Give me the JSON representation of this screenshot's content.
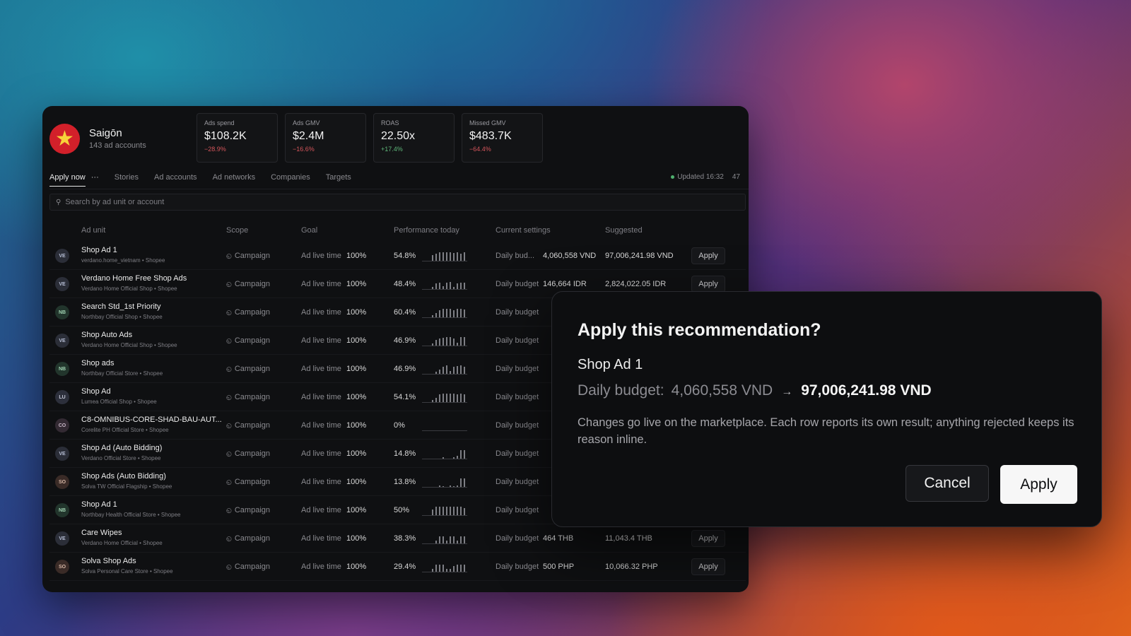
{
  "org": {
    "name": "Saigōn",
    "subtitle": "143 ad accounts"
  },
  "kpis": [
    {
      "label": "Ads spend",
      "value": "$108.2K",
      "delta": "−28.9%",
      "trend": "negative"
    },
    {
      "label": "Ads GMV",
      "value": "$2.4M",
      "delta": "−16.6%",
      "trend": "negative"
    },
    {
      "label": "ROAS",
      "value": "22.50x",
      "delta": "+17.4%",
      "trend": "positive"
    },
    {
      "label": "Missed GMV",
      "value": "$483.7K",
      "delta": "−64.4%",
      "trend": "negative"
    }
  ],
  "tabs": {
    "apply_now": "Apply now",
    "more": "···",
    "stories": "Stories",
    "ad_accounts": "Ad accounts",
    "ad_networks": "Ad networks",
    "companies": "Companies",
    "targets": "Targets"
  },
  "status": {
    "updated": "Updated 16:32",
    "count": "47"
  },
  "search": {
    "placeholder": "Search by ad unit or account"
  },
  "columns": {
    "ad_unit": "Ad unit",
    "scope": "Scope",
    "goal": "Goal",
    "performance": "Performance today",
    "current": "Current settings",
    "suggested": "Suggested"
  },
  "rows": [
    {
      "initials": "VE",
      "name": "Shop Ad 1",
      "sub": "verdano.home_vietnam • Shopee",
      "scope": "Campaign",
      "goal": "Ad live time",
      "goal_pct": "100%",
      "perf": "54.8%",
      "setting_label": "Daily bud...",
      "setting_value": "4,060,558 VND",
      "suggested": "97,006,241.98 VND",
      "apply": "Apply"
    },
    {
      "initials": "VE",
      "name": "Verdano Home Free Shop Ads",
      "sub": "Verdano Home Official Shop • Shopee",
      "scope": "Campaign",
      "goal": "Ad live time",
      "goal_pct": "100%",
      "perf": "48.4%",
      "setting_label": "Daily budget",
      "setting_value": "146,664 IDR",
      "suggested": "2,824,022.05 IDR",
      "apply": "Apply"
    },
    {
      "initials": "NB",
      "name": "Search Std_1st Priority",
      "sub": "Northbay Official Shop • Shopee",
      "scope": "Campaign",
      "goal": "Ad live time",
      "goal_pct": "100%",
      "perf": "60.4%",
      "setting_label": "Daily budget",
      "setting_value": "",
      "suggested": "",
      "apply": ""
    },
    {
      "initials": "VE",
      "name": "Shop Auto Ads",
      "sub": "Verdano Home Official Shop • Shopee",
      "scope": "Campaign",
      "goal": "Ad live time",
      "goal_pct": "100%",
      "perf": "46.9%",
      "setting_label": "Daily budget",
      "setting_value": "",
      "suggested": "",
      "apply": ""
    },
    {
      "initials": "NB",
      "name": "Shop ads",
      "sub": "Northbay Official Store • Shopee",
      "scope": "Campaign",
      "goal": "Ad live time",
      "goal_pct": "100%",
      "perf": "46.9%",
      "setting_label": "Daily budget",
      "setting_value": "",
      "suggested": "",
      "apply": ""
    },
    {
      "initials": "LU",
      "name": "Shop Ad",
      "sub": "Lumea Official Shop • Shopee",
      "scope": "Campaign",
      "goal": "Ad live time",
      "goal_pct": "100%",
      "perf": "54.1%",
      "setting_label": "Daily budget",
      "setting_value": "",
      "suggested": "",
      "apply": ""
    },
    {
      "initials": "CO",
      "name": "C8-OMNIBUS-CORE-SHAD-BAU-AUT...",
      "sub": "Corelite PH Official Store • Shopee",
      "scope": "Campaign",
      "goal": "Ad live time",
      "goal_pct": "100%",
      "perf": "0%",
      "setting_label": "Daily budget",
      "setting_value": "",
      "suggested": "",
      "apply": ""
    },
    {
      "initials": "VE",
      "name": "Shop Ad (Auto Bidding)",
      "sub": "Verdano Official Store • Shopee",
      "scope": "Campaign",
      "goal": "Ad live time",
      "goal_pct": "100%",
      "perf": "14.8%",
      "setting_label": "Daily budget",
      "setting_value": "",
      "suggested": "",
      "apply": ""
    },
    {
      "initials": "SO",
      "name": "Shop Ads (Auto Bidding)",
      "sub": "Solva TW Official Flagship • Shopee",
      "scope": "Campaign",
      "goal": "Ad live time",
      "goal_pct": "100%",
      "perf": "13.8%",
      "setting_label": "Daily budget",
      "setting_value": "",
      "suggested": "",
      "apply": ""
    },
    {
      "initials": "NB",
      "name": "Shop Ad 1",
      "sub": "Northbay Health Official Store • Shopee",
      "scope": "Campaign",
      "goal": "Ad live time",
      "goal_pct": "100%",
      "perf": "50%",
      "setting_label": "Daily budget",
      "setting_value": "",
      "suggested": "",
      "apply": ""
    },
    {
      "initials": "VE",
      "name": "Care Wipes",
      "sub": "Verdano Home Official • Shopee",
      "scope": "Campaign",
      "goal": "Ad live time",
      "goal_pct": "100%",
      "perf": "38.3%",
      "setting_label": "Daily budget",
      "setting_value": "464 THB",
      "suggested": "11,043.4 THB",
      "apply": "Apply"
    },
    {
      "initials": "SO",
      "name": "Solva Shop Ads",
      "sub": "Solva Personal Care Store • Shopee",
      "scope": "Campaign",
      "goal": "Ad live time",
      "goal_pct": "100%",
      "perf": "29.4%",
      "setting_label": "Daily budget",
      "setting_value": "500 PHP",
      "suggested": "10,066.32 PHP",
      "apply": "Apply"
    }
  ],
  "modal": {
    "title": "Apply this recommendation?",
    "ad_unit": "Shop Ad 1",
    "budget_label": "Daily budget:",
    "budget_from": "4,060,558 VND",
    "arrow": "→",
    "budget_to": "97,006,241.98 VND",
    "description": "Changes go live on the marketplace. Each row reports its own result; anything rejected keeps its reason inline.",
    "cancel_label": "Cancel",
    "apply_label": "Apply"
  },
  "icons": {
    "org_badge": "star-icon",
    "scope": "campaign-icon",
    "search": "search-icon"
  },
  "colors": {
    "org_badge_bg": "#d2202a",
    "org_badge_star": "#f7d23a",
    "negative": "#d4555b",
    "positive": "#5fb87a",
    "status_dot": "#4fb06e"
  }
}
